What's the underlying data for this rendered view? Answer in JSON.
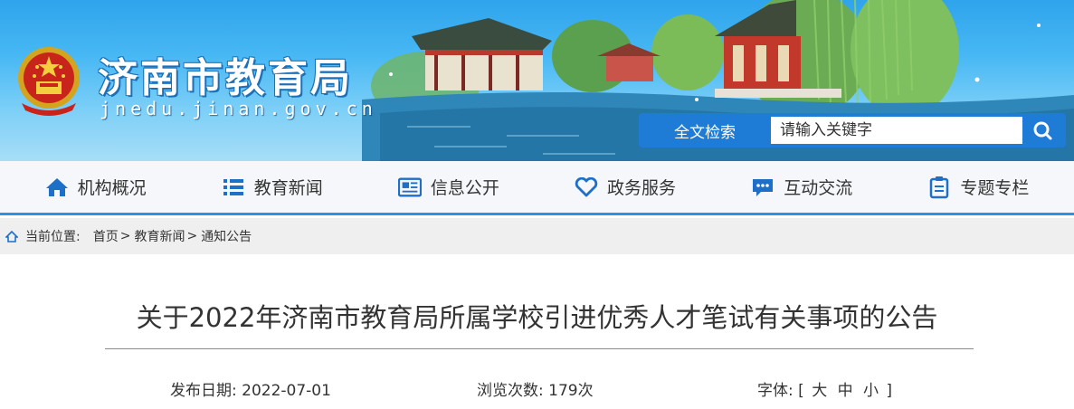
{
  "banner": {
    "site_name": "济南市教育局",
    "site_url": "jnedu.jinan.gov.cn",
    "logo_icon": "national-emblem-icon"
  },
  "search": {
    "label": "全文检索",
    "placeholder": "请输入关键字",
    "button_icon": "search-icon"
  },
  "nav": {
    "items": [
      {
        "label": "机构概况",
        "icon": "home-icon"
      },
      {
        "label": "教育新闻",
        "icon": "list-icon"
      },
      {
        "label": "信息公开",
        "icon": "newspaper-icon"
      },
      {
        "label": "政务服务",
        "icon": "heart-icon"
      },
      {
        "label": "互动交流",
        "icon": "chat-icon"
      },
      {
        "label": "专题专栏",
        "icon": "clipboard-icon"
      }
    ]
  },
  "breadcrumb": {
    "label": "当前位置:",
    "items": [
      "首页",
      "教育新闻",
      "通知公告"
    ],
    "separator": ">"
  },
  "article": {
    "title": "关于2022年济南市教育局所属学校引进优秀人才笔试有关事项的公告",
    "date_label": "发布日期:",
    "date": "2022-07-01",
    "views_label": "浏览次数:",
    "views": "179次",
    "font_label": "字体:",
    "font_open": "[",
    "font_large": "大",
    "font_medium": "中",
    "font_small": "小",
    "font_close": "]"
  },
  "colors": {
    "accent": "#1e7bd6",
    "nav_border": "#2f8fe0",
    "icon": "#1e6fc8"
  }
}
